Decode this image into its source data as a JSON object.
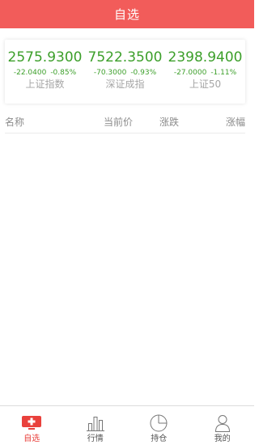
{
  "header": {
    "title": "自选"
  },
  "indices": [
    {
      "value": "2575.9300",
      "change": "-22.0400",
      "percent": "-0.85%",
      "name": "上证指数"
    },
    {
      "value": "7522.3500",
      "change": "-70.3000",
      "percent": "-0.93%",
      "name": "深证成指"
    },
    {
      "value": "2398.9400",
      "change": "-27.0000",
      "percent": "-1.11%",
      "name": "上证50"
    }
  ],
  "list_header": {
    "name": "名称",
    "price": "当前价",
    "change": "涨跌",
    "percent": "涨幅"
  },
  "tabs": [
    {
      "label": "自选",
      "icon": "favorites-add-icon",
      "active": true
    },
    {
      "label": "行情",
      "icon": "bar-chart-icon",
      "active": false
    },
    {
      "label": "持仓",
      "icon": "pie-chart-icon",
      "active": false
    },
    {
      "label": "我的",
      "icon": "user-icon",
      "active": false
    }
  ],
  "colors": {
    "brand": "#f25c5a",
    "down": "#3c9f2a",
    "active_tab": "#e9413c",
    "muted": "#a6a6a6"
  }
}
